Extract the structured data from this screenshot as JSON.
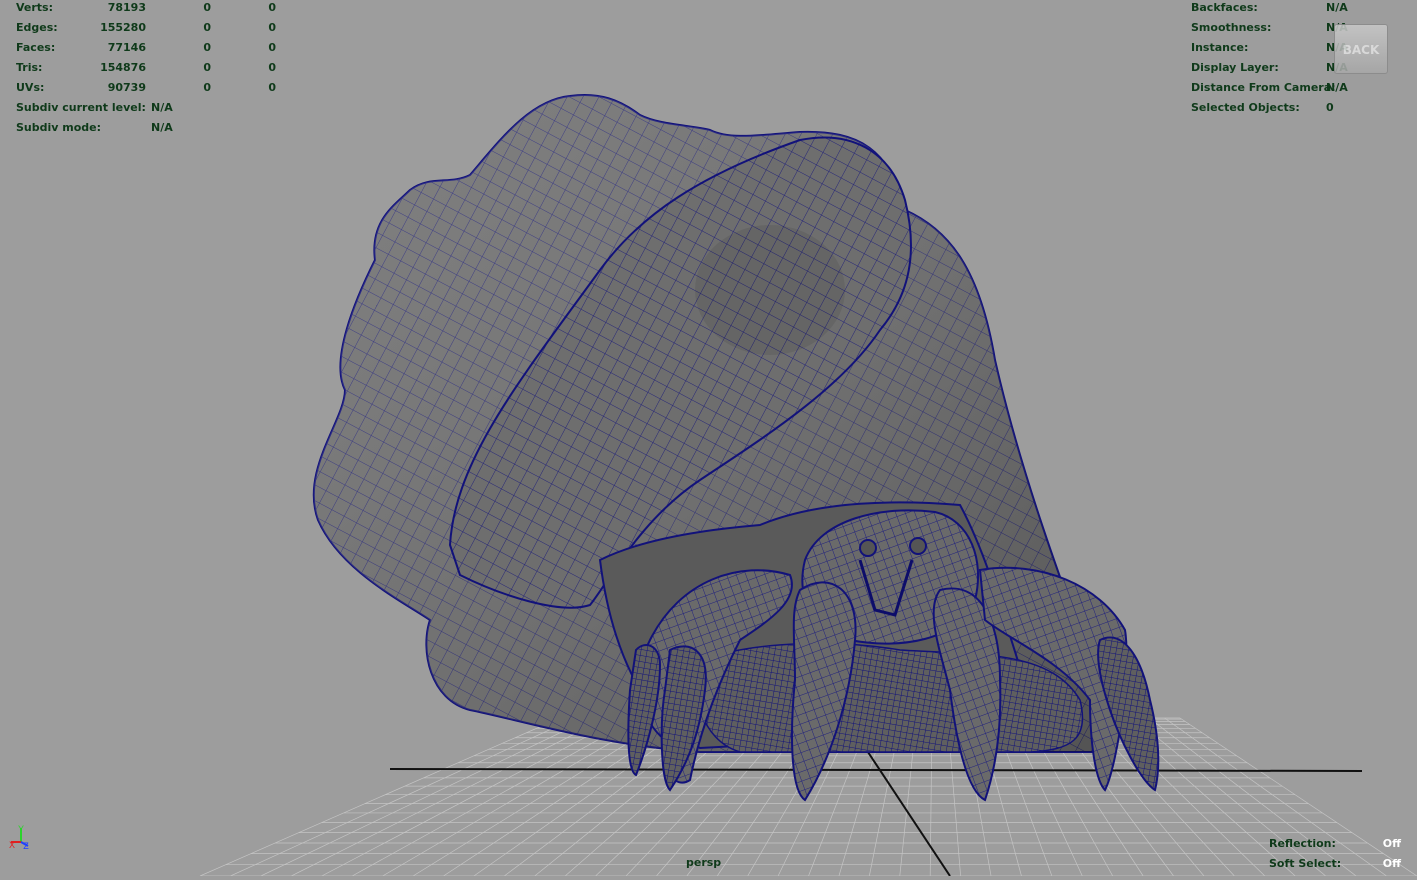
{
  "stats_left": [
    {
      "label": "Verts:",
      "v1": "78193",
      "v2": "0",
      "v3": "0"
    },
    {
      "label": "Edges:",
      "v1": "155280",
      "v2": "0",
      "v3": "0"
    },
    {
      "label": "Faces:",
      "v1": "77146",
      "v2": "0",
      "v3": "0"
    },
    {
      "label": "Tris:",
      "v1": "154876",
      "v2": "0",
      "v3": "0"
    },
    {
      "label": "UVs:",
      "v1": "90739",
      "v2": "0",
      "v3": "0"
    }
  ],
  "subdiv": [
    {
      "label": "Subdiv current level:",
      "value": "N/A"
    },
    {
      "label": "Subdiv mode:",
      "value": "N/A"
    }
  ],
  "stats_right": [
    {
      "label": "Backfaces:",
      "value": "N/A"
    },
    {
      "label": "Smoothness:",
      "value": "N/A"
    },
    {
      "label": "Instance:",
      "value": "N/A"
    },
    {
      "label": "Display Layer:",
      "value": "N/A"
    },
    {
      "label": "Distance From Camera:",
      "value": "N/A"
    },
    {
      "label": "Selected Objects:",
      "value": "0"
    }
  ],
  "view_cube": {
    "label": "BACK"
  },
  "camera": {
    "name": "persp"
  },
  "status": {
    "reflection_label": "Reflection:",
    "reflection_value": "Off",
    "soft_select_label": "Soft Select:",
    "soft_select_value": "Off"
  },
  "axis": {
    "x": "X",
    "y": "Y",
    "z": "Z"
  },
  "colors": {
    "background": "#9d9d9d",
    "hud_text": "#0f3a1a",
    "wireframe": "#14148a",
    "mesh": "#6e6e6e"
  }
}
